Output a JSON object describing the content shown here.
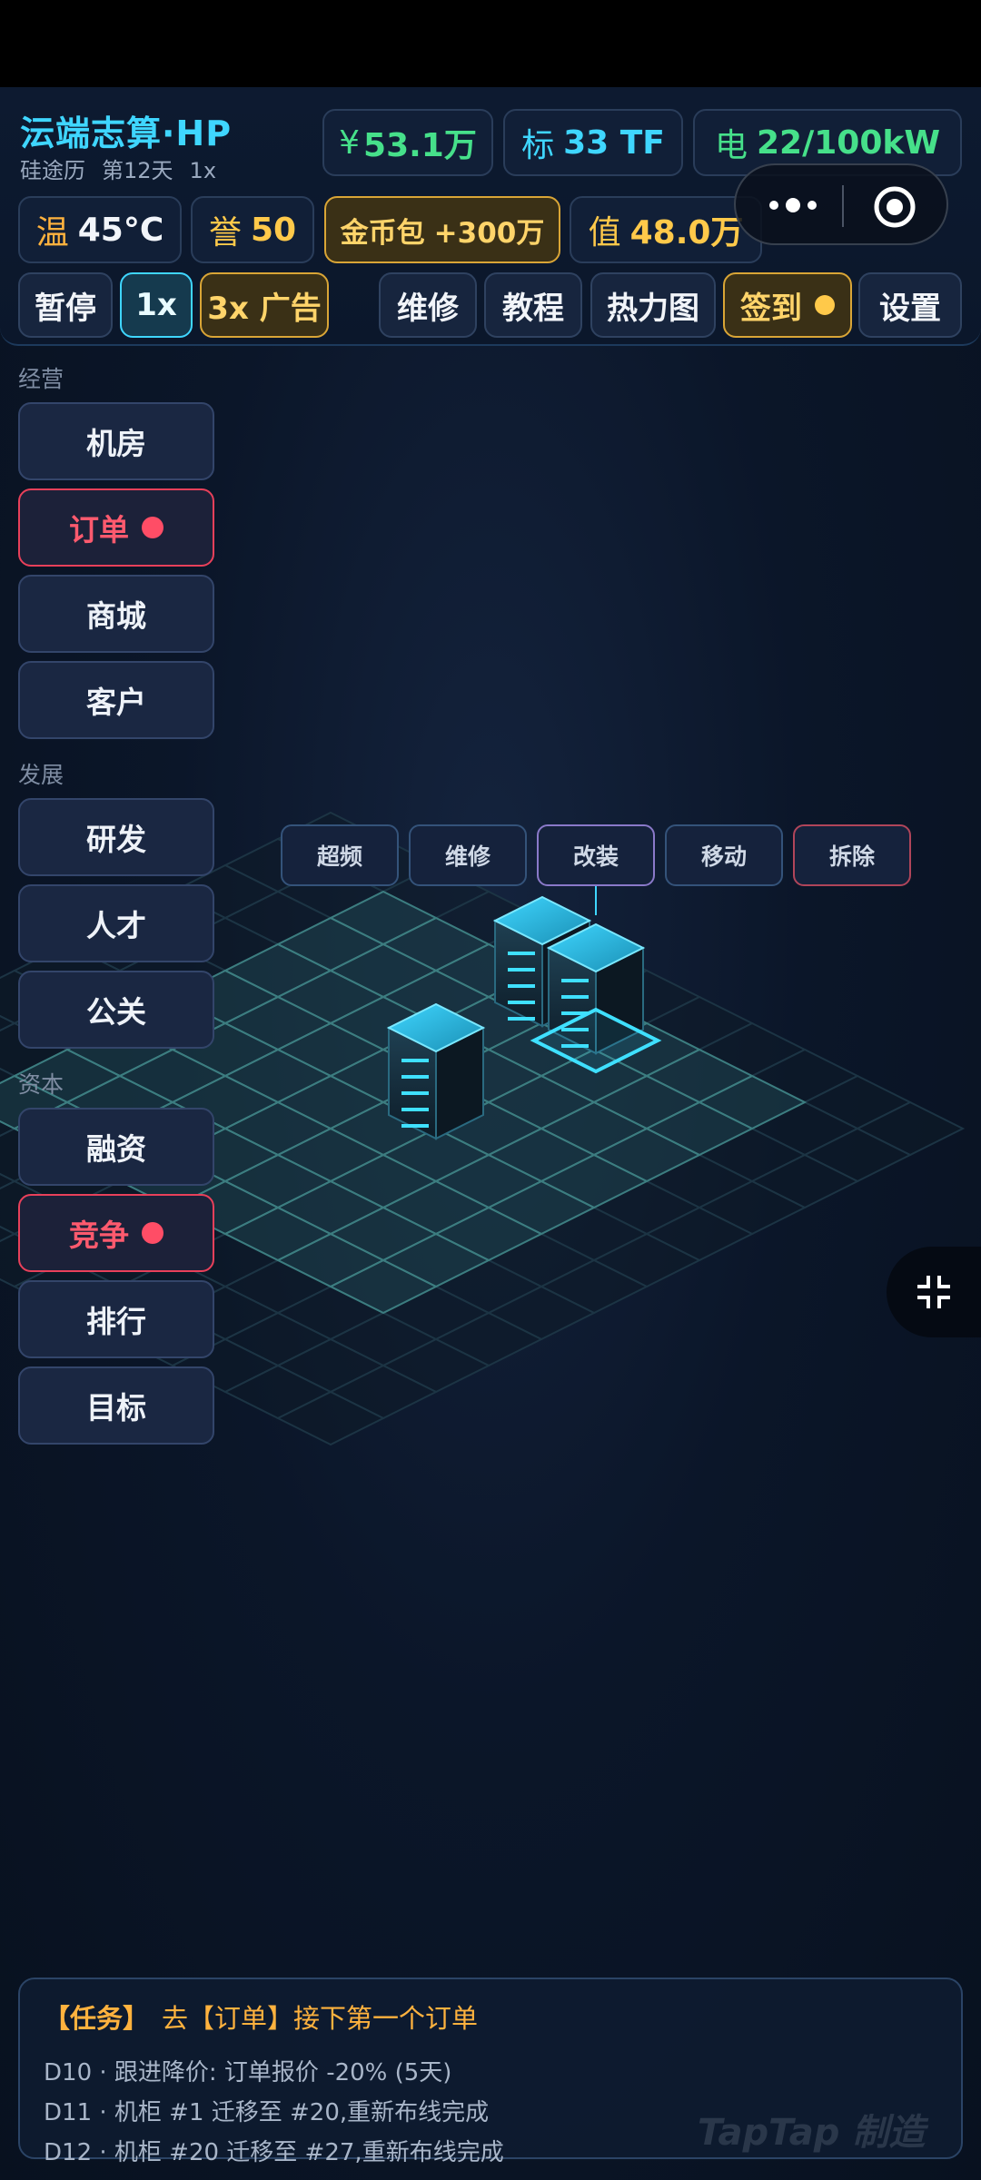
{
  "header": {
    "title": "沄端志算·HP",
    "calendar": "硅途历",
    "day": "第12天",
    "speed": "1x"
  },
  "stats": {
    "money": {
      "label": "¥",
      "value": "53.1万"
    },
    "compute": {
      "label": "标",
      "value": "33 TF"
    },
    "power": {
      "label": "电",
      "value": "22/100kW"
    },
    "temp": {
      "label": "温",
      "value": "45°C"
    },
    "reputation": {
      "label": "誉",
      "value": "50"
    },
    "coin_pack": {
      "label": "金币包",
      "value": "+300万"
    },
    "valuation": {
      "label": "值",
      "value": "48.0万"
    }
  },
  "toolbar": {
    "pause": "暂停",
    "speed1": "1x",
    "speed3": "3x 广告",
    "repair": "维修",
    "tutorial": "教程",
    "heatmap": "热力图",
    "checkin": "签到",
    "settings": "设置"
  },
  "sidebar": {
    "sections": [
      {
        "title": "经营",
        "items": [
          {
            "label": "机房"
          },
          {
            "label": "订单"
          },
          {
            "label": "商城"
          },
          {
            "label": "客户"
          }
        ]
      },
      {
        "title": "发展",
        "items": [
          {
            "label": "研发"
          },
          {
            "label": "人才"
          },
          {
            "label": "公关"
          }
        ]
      },
      {
        "title": "资本",
        "items": [
          {
            "label": "融资"
          },
          {
            "label": "竞争"
          },
          {
            "label": "排行"
          },
          {
            "label": "目标"
          }
        ]
      }
    ]
  },
  "context_menu": {
    "overclock": "超频",
    "repair": "维修",
    "modify": "改装",
    "move": "移动",
    "demolish": "拆除"
  },
  "task": {
    "tag": "【任务】",
    "text": "去【订单】接下第一个订单",
    "log": [
      "D10 · 跟进降价: 订单报价 -20% (5天)",
      "D11 · 机柜 #1 迁移至 #20,重新布线完成",
      "D12 · 机柜 #20 迁移至 #27,重新布线完成"
    ]
  },
  "watermark": "TapTap 制造",
  "colors": {
    "accent": "#3fd6ff",
    "money": "#46e08a",
    "power": "#46e08a",
    "gold": "#ffc94a",
    "alert": "#ff4d66",
    "task": "#ffb23e"
  }
}
